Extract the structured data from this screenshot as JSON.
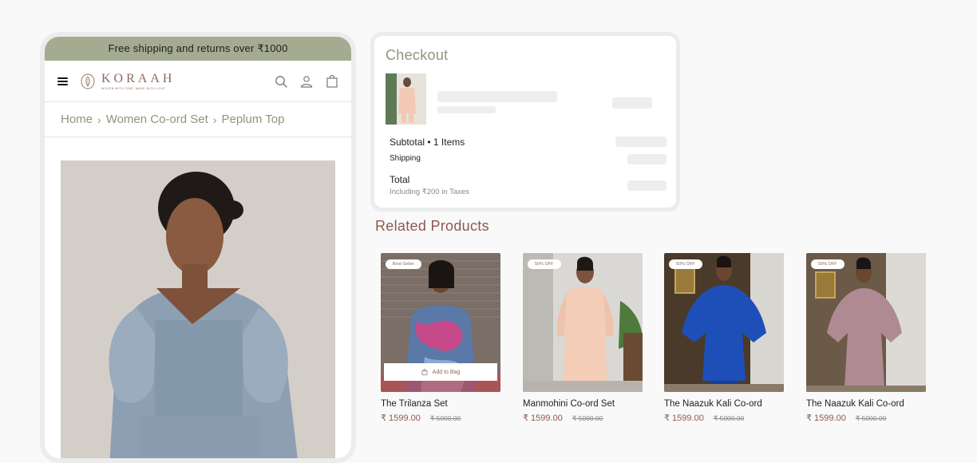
{
  "promo": {
    "text": "Free shipping and returns over ₹1000"
  },
  "brand": {
    "name": "KORAAH",
    "tagline": "WOVEN WITH TIME, MADE WITH LOVE"
  },
  "breadcrumb": [
    "Home",
    "Women Co-ord Set",
    "Peplum Top"
  ],
  "checkout": {
    "title": "Checkout",
    "subtotal_label": "Subtotal • 1 Items",
    "shipping_label": "Shipping",
    "total_label": "Total",
    "tax_note": "Including ₹200 in Taxes"
  },
  "related": {
    "title": "Related Products",
    "add_to_bag": "Add to Bag",
    "items": [
      {
        "name": "The Trilanza Set",
        "price": "₹ 1599.00",
        "old_price": "₹ 5000.00",
        "badge": "Best Seller"
      },
      {
        "name": "Manmohini Co-ord Set",
        "price": "₹ 1599.00",
        "old_price": "₹ 5000.00",
        "badge": "50% OFF"
      },
      {
        "name": "The Naazuk Kali Co-ord",
        "price": "₹ 1599.00",
        "old_price": "₹ 5000.00",
        "badge": "50% OFF"
      },
      {
        "name": "The Naazuk Kali Co-ord",
        "price": "₹ 1599.00",
        "old_price": "₹ 5000.00",
        "badge": "50% OFF"
      }
    ]
  },
  "colors": {
    "accent": "#a4ab90",
    "brand": "#8c5a4d",
    "sage_text": "#8d9679"
  }
}
